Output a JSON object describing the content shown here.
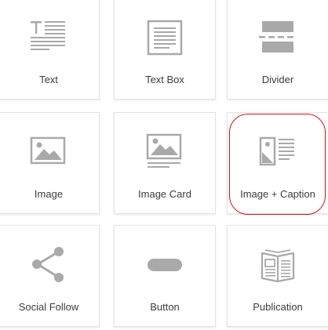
{
  "blocks": [
    {
      "label": "Text",
      "icon": "text-icon"
    },
    {
      "label": "Text Box",
      "icon": "text-box-icon"
    },
    {
      "label": "Divider",
      "icon": "divider-icon"
    },
    {
      "label": "Image",
      "icon": "image-icon"
    },
    {
      "label": "Image Card",
      "icon": "image-card-icon"
    },
    {
      "label": "Image + Caption",
      "icon": "image-caption-icon"
    },
    {
      "label": "Social Follow",
      "icon": "share-icon"
    },
    {
      "label": "Button",
      "icon": "button-icon"
    },
    {
      "label": "Publication",
      "icon": "publication-icon"
    }
  ],
  "colors": {
    "icon": "#a9a9a9",
    "label": "#3d3d3d",
    "highlight": "#d0131e"
  }
}
